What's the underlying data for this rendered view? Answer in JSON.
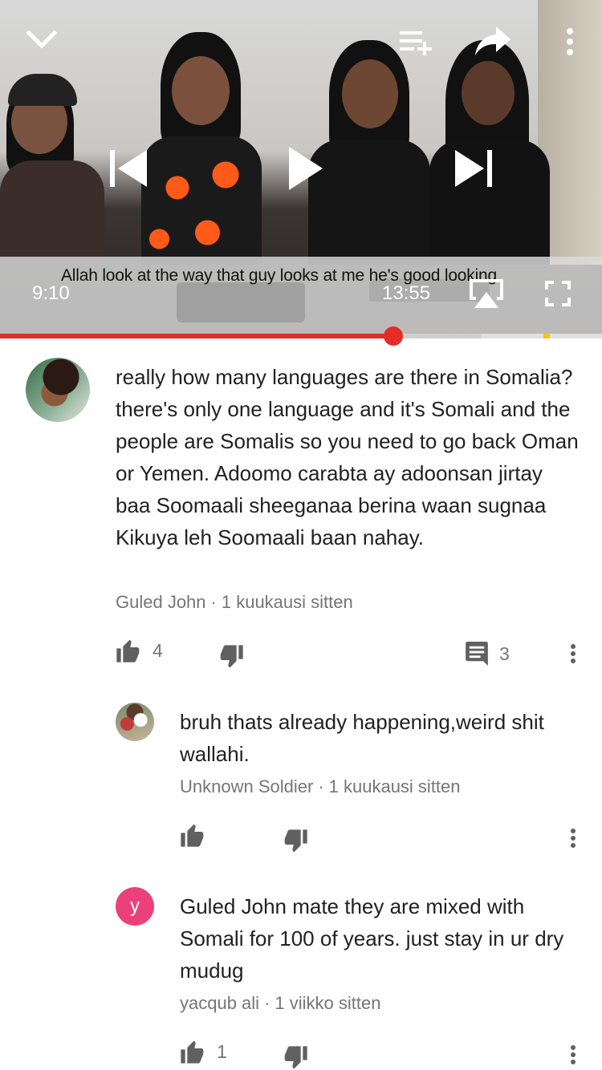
{
  "player": {
    "caption": "Allah look at the way that guy looks at me he's good looking",
    "current_time": "9:10",
    "total_time": "13:55",
    "progress_played_fraction": 0.653,
    "progress_buffered_fraction": 0.8,
    "colors": {
      "progress": "#e52d27",
      "marker": "#f6c21c"
    },
    "icons": [
      "chevron-down-icon",
      "add-to-queue-icon",
      "share-icon",
      "more-vert-icon",
      "skip-previous-icon",
      "play-icon",
      "skip-next-icon",
      "airplay-icon",
      "fullscreen-icon"
    ]
  },
  "comments": [
    {
      "text": "really how many languages are there in Somalia? there's only one language and it's Somali and the people are Somalis so you need to go back Oman or Yemen. Adoomo carabta ay adoonsan jirtay baa Soomaali sheeganaa berina waan sugnaa Kikuya leh Soomaali baan nahay.",
      "author": "Guled John",
      "time": "1 kuukausi sitten",
      "likes": "4",
      "replies": "3"
    },
    {
      "text": "bruh thats already happening,weird shit wallahi.",
      "author": "Unknown Soldier",
      "time": "1 kuukausi sitten",
      "likes": ""
    },
    {
      "text": "Guled John  mate they are mixed with Somali for 100 of years. just stay in ur dry mudug",
      "author": "yacqub ali",
      "time": "1 viikko sitten",
      "avatar_letter": "y",
      "avatar_color": "#ec407a",
      "likes": "1"
    }
  ],
  "meta_separator": "·"
}
